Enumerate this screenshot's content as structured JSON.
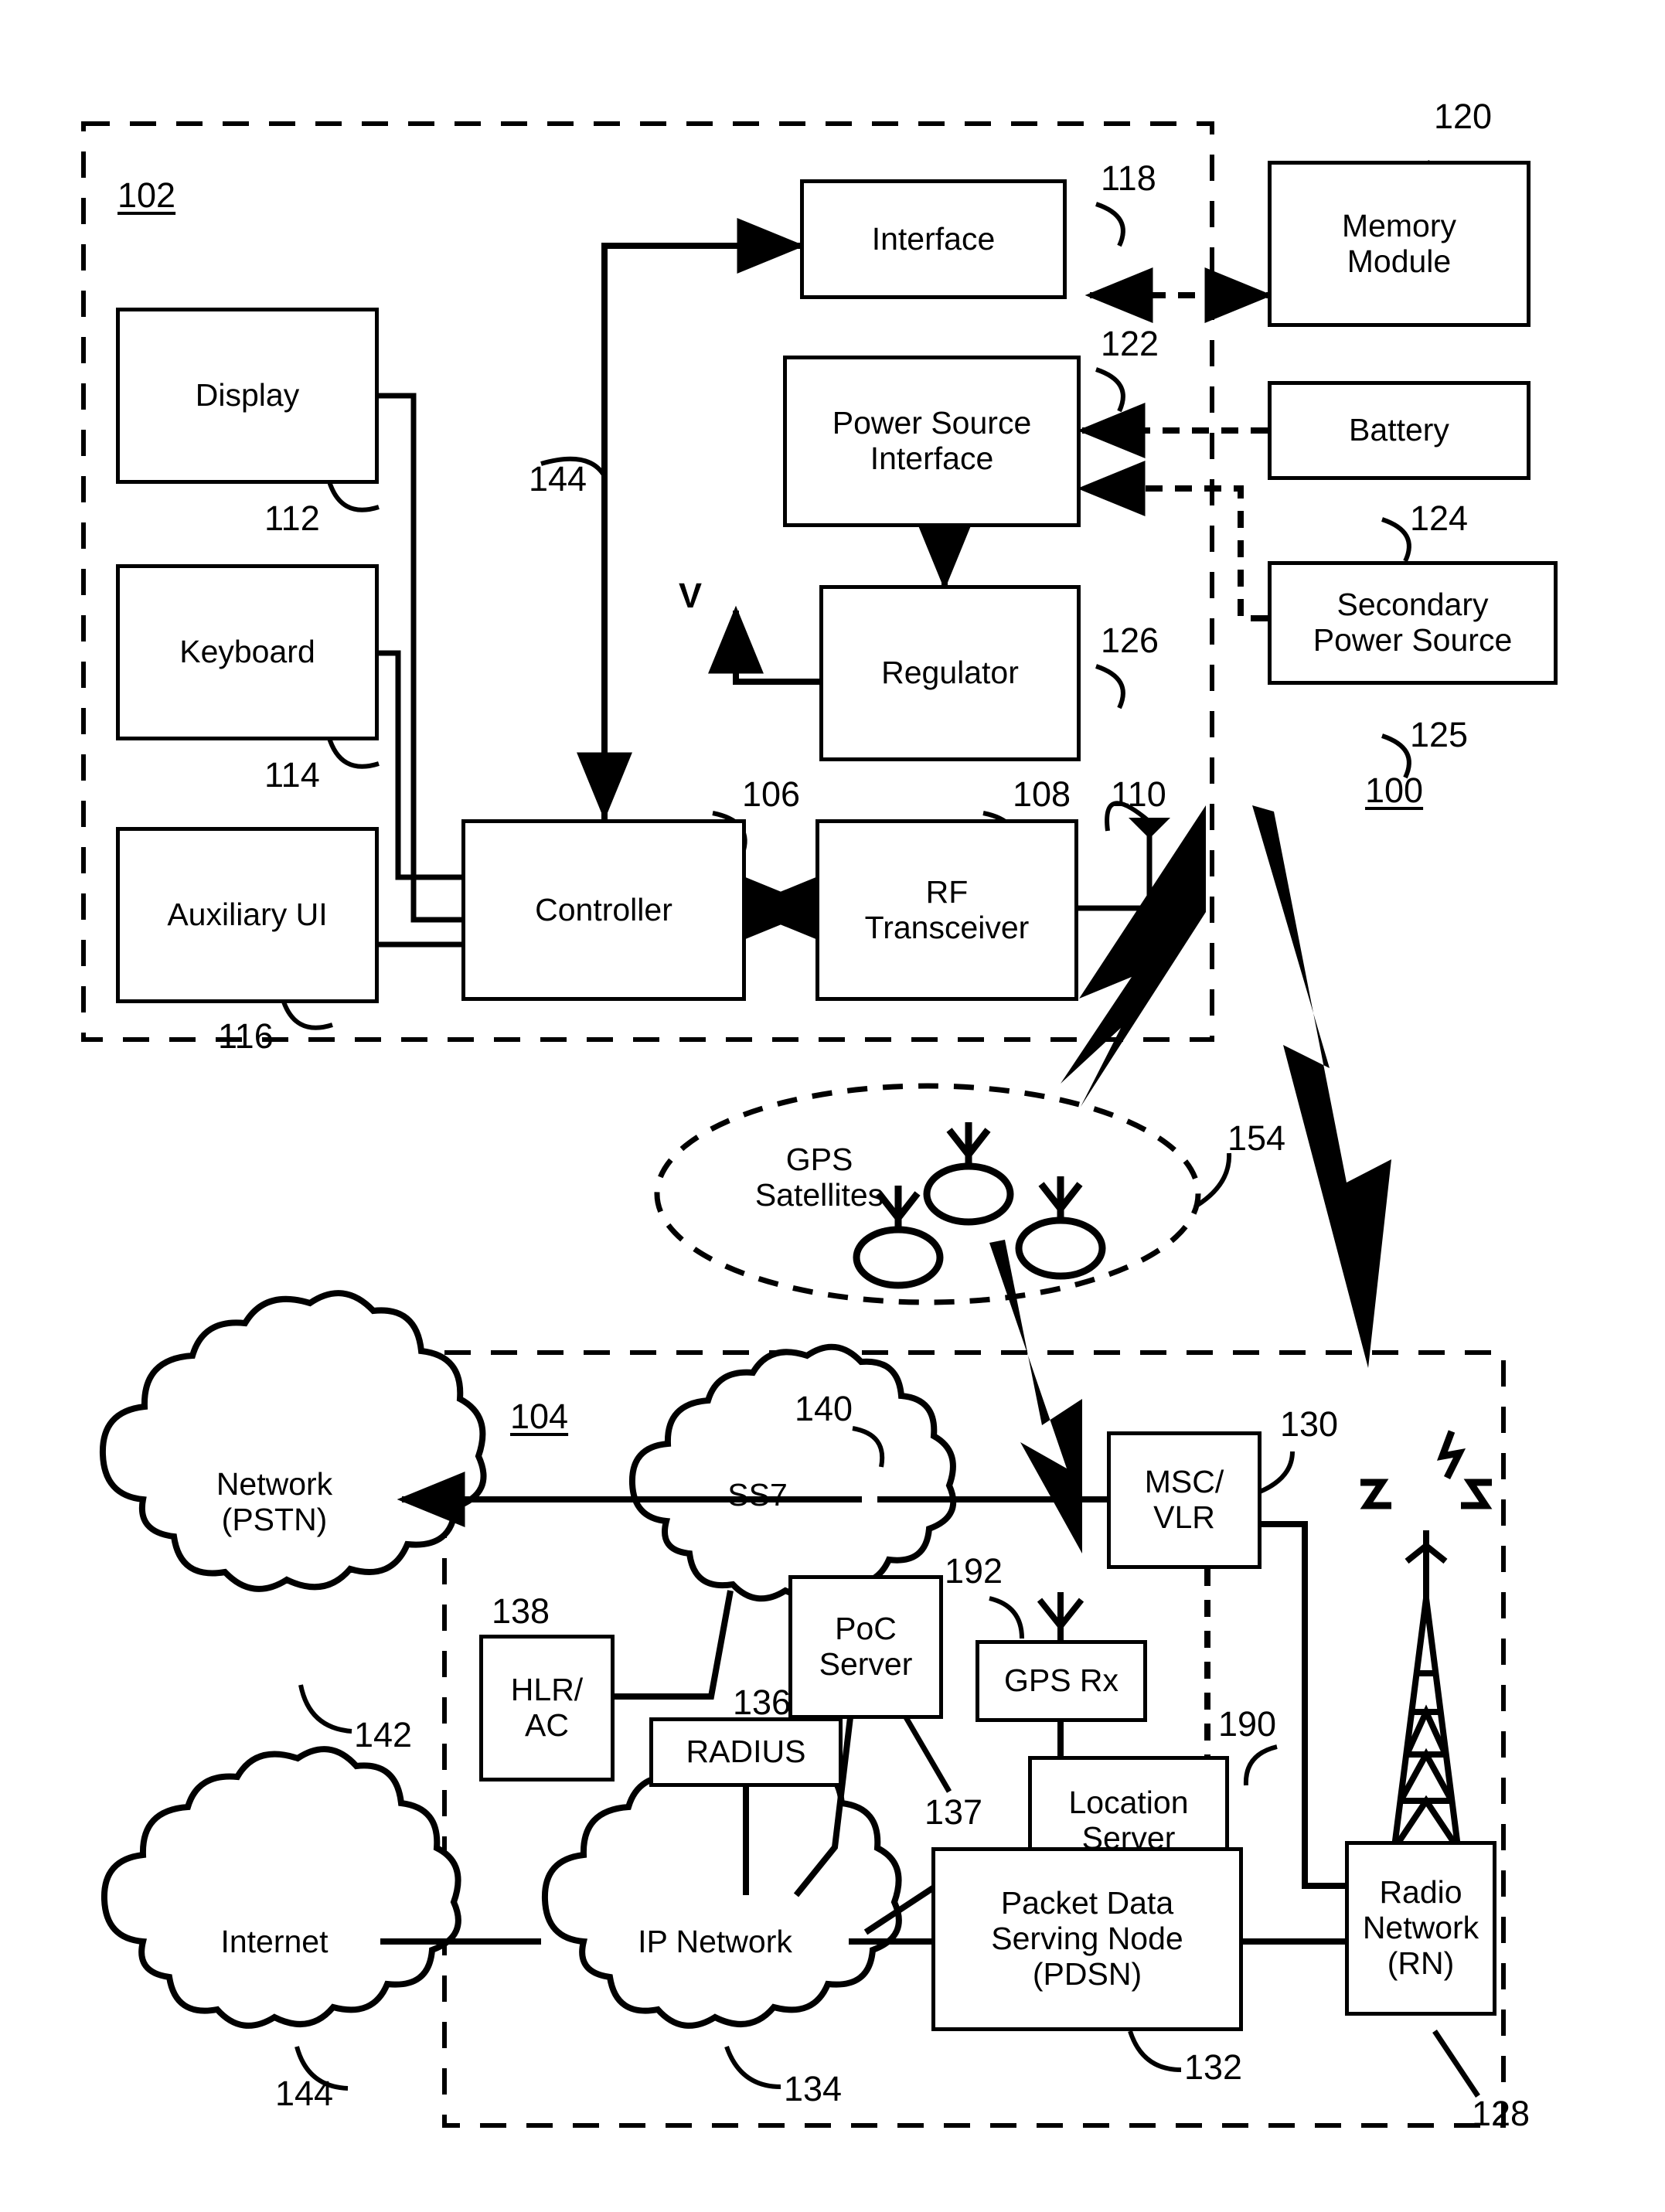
{
  "figure": {
    "system_ref": "100",
    "device_ref": "102",
    "network_ref": "104",
    "gps_group_ref": "154"
  },
  "device_blocks": [
    {
      "id": "display",
      "label": "Display",
      "ref": "112"
    },
    {
      "id": "keyboard",
      "label": "Keyboard",
      "ref": "114"
    },
    {
      "id": "aux_ui",
      "label": "Auxiliary UI",
      "ref": "116"
    },
    {
      "id": "controller",
      "label": "Controller",
      "ref": "106"
    },
    {
      "id": "rf_trx",
      "label": "RF\nTransceiver",
      "ref": "108"
    },
    {
      "id": "interface",
      "label": "Interface",
      "ref": "118"
    },
    {
      "id": "psi",
      "label": "Power Source\nInterface",
      "ref": "122"
    },
    {
      "id": "regulator",
      "label": "Regulator",
      "ref": "126"
    }
  ],
  "external_blocks": [
    {
      "id": "memory",
      "label": "Memory\nModule",
      "ref": "120"
    },
    {
      "id": "battery",
      "label": "Battery",
      "ref": "124"
    },
    {
      "id": "secpower",
      "label": "Secondary\nPower Source",
      "ref": "125"
    }
  ],
  "antenna_ref": "110",
  "bus_ref": "144",
  "voltage_label": "V",
  "gps": {
    "label": "GPS\nSatellites",
    "ref": "154",
    "satellite_count": 3
  },
  "network_blocks": [
    {
      "id": "hlr_ac",
      "label": "HLR/\nAC",
      "ref": "138"
    },
    {
      "id": "radius",
      "label": "RADIUS",
      "ref": "136"
    },
    {
      "id": "poc",
      "label": "PoC\nServer",
      "ref": "137"
    },
    {
      "id": "gps_rx",
      "label": "GPS Rx",
      "ref": "192"
    },
    {
      "id": "msc_vlr",
      "label": "MSC/\nVLR",
      "ref": "130"
    },
    {
      "id": "loc_srv",
      "label": "Location\nServer",
      "ref": "190"
    },
    {
      "id": "pdsn",
      "label": "Packet Data\nServing Node\n(PDSN)",
      "ref": "132"
    },
    {
      "id": "rn",
      "label": "Radio\nNetwork\n(RN)",
      "ref": "128"
    }
  ],
  "clouds": [
    {
      "id": "pstn",
      "label": "Network\n(PSTN)",
      "ref": "142"
    },
    {
      "id": "ss7",
      "label": "SS7",
      "ref": "140"
    },
    {
      "id": "internet",
      "label": "Internet",
      "ref": "144"
    },
    {
      "id": "ipnet",
      "label": "IP Network",
      "ref": "134"
    }
  ],
  "colors": {
    "ink": "#000000",
    "paper": "#ffffff"
  }
}
